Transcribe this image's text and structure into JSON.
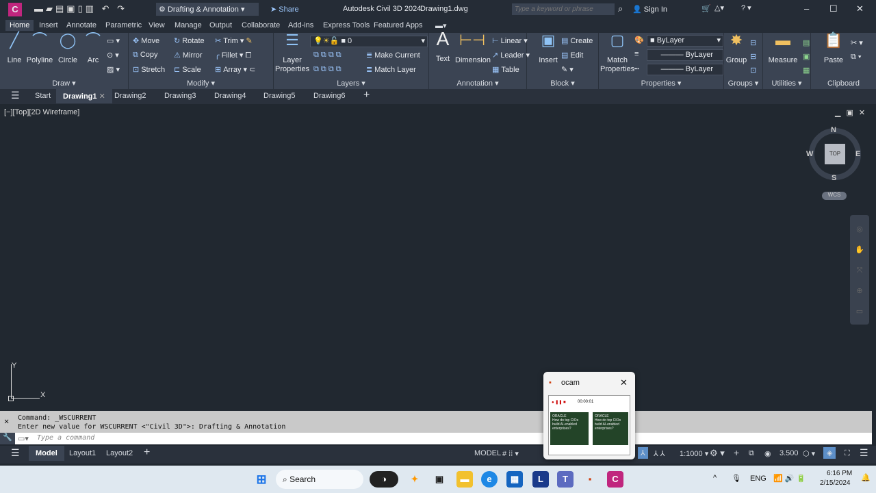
{
  "app": {
    "title": "Autodesk Civil 3D 2024",
    "file": "Drawing1.dwg",
    "logo": "C",
    "workspace": "Drafting & Annotation",
    "share": "Share",
    "search_placeholder": "Type a keyword or phrase",
    "sign_in": "Sign In"
  },
  "ribbon_tabs": [
    "Home",
    "Insert",
    "Annotate",
    "Parametric",
    "View",
    "Manage",
    "Output",
    "Collaborate",
    "Add-ins",
    "Express Tools",
    "Featured Apps"
  ],
  "active_ribbon_tab": "Home",
  "panels": {
    "draw": {
      "title": "Draw",
      "items": [
        "Line",
        "Polyline",
        "Circle",
        "Arc"
      ]
    },
    "modify": {
      "title": "Modify",
      "items": [
        "Move",
        "Rotate",
        "Trim",
        "Copy",
        "Mirror",
        "Fillet",
        "Stretch",
        "Scale",
        "Array"
      ]
    },
    "layers": {
      "title": "Layers",
      "layer_properties": "Layer Properties",
      "current_layer": "0",
      "make_current": "Make Current",
      "match_layer": "Match Layer"
    },
    "annotation": {
      "title": "Annotation",
      "text": "Text",
      "dimension": "Dimension",
      "linear": "Linear",
      "leader": "Leader",
      "table": "Table"
    },
    "block": {
      "title": "Block",
      "insert": "Insert",
      "create": "Create",
      "edit": "Edit"
    },
    "properties": {
      "title": "Properties",
      "match": "Match Properties",
      "color": "ByLayer",
      "linetype": "ByLayer",
      "lineweight": "ByLayer"
    },
    "groups": {
      "title": "Groups",
      "group": "Group"
    },
    "utilities": {
      "title": "Utilities",
      "measure": "Measure"
    },
    "clipboard": {
      "title": "Clipboard",
      "paste": "Paste"
    }
  },
  "doc_tabs": [
    "Start",
    "Drawing1",
    "Drawing2",
    "Drawing3",
    "Drawing4",
    "Drawing5",
    "Drawing6"
  ],
  "active_doc": "Drawing1",
  "viewport": {
    "label": "[−][Top][2D Wireframe]",
    "viewcube": {
      "top": "TOP",
      "n": "N",
      "s": "S",
      "e": "E",
      "w": "W",
      "wcs": "WCS"
    },
    "ucs_x": "X",
    "ucs_y": "Y"
  },
  "command": {
    "line1": "Command: _WSCURRENT",
    "line2": "Enter new value for WSCURRENT <\"Civil 3D\">: Drafting & Annotation",
    "placeholder": "Type a command"
  },
  "layout_tabs": [
    "Model",
    "Layout1",
    "Layout2"
  ],
  "status": {
    "model": "MODEL",
    "scale": "1:1000",
    "annotation_scale": "3.500"
  },
  "ocam_popup": {
    "title": "ocam",
    "timer": "00:00:01",
    "ad_brand": "ORACLE",
    "ad_text": "How do top CIOs build AI-enabled enterprises?"
  },
  "taskbar": {
    "search": "Search",
    "lang": "ENG",
    "time": "6:16 PM",
    "date": "2/15/2024"
  },
  "colors": {
    "ribbon": "#3b4453",
    "viewport": "#212830",
    "accent": "#7dbaf0",
    "logo": "#c0267e"
  }
}
